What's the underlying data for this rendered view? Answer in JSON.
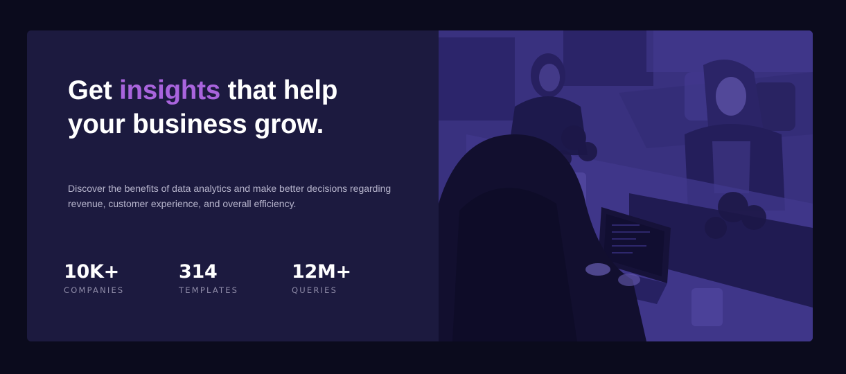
{
  "hero": {
    "headline_before": "Get ",
    "headline_accent": "insights",
    "headline_after": " that help your business grow.",
    "description": "Discover the benefits of data analytics and make better decisions regarding revenue, customer experience, and overall efficiency."
  },
  "stats": [
    {
      "value": "10K+",
      "label": "COMPANIES"
    },
    {
      "value": "314",
      "label": "TEMPLATES"
    },
    {
      "value": "12M+",
      "label": "QUERIES"
    }
  ],
  "image": {
    "subject": "team working with laptops at an office table"
  },
  "colors": {
    "page_background": "#0b0b1d",
    "card_background": "#1c1a3f",
    "accent": "#a964dd",
    "image_tint": "#4a3f97",
    "stat_label": "#8f8ca8"
  }
}
